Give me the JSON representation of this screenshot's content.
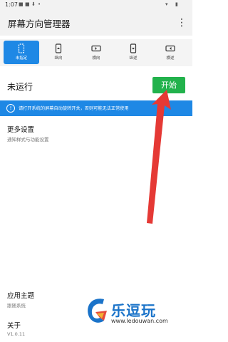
{
  "status_bar": {
    "time": "1:07",
    "icons": [
      "app-icon",
      "app-icon",
      "download-icon",
      "dot-icon",
      "wifi-icon",
      "battery-icon"
    ]
  },
  "app": {
    "title": "屏幕方向管理器",
    "menu_icon": "more-vert-icon"
  },
  "modes": [
    {
      "label": "未指定",
      "icon": "phone-outline-icon",
      "selected": true
    },
    {
      "label": "纵向",
      "icon": "portrait-icon",
      "selected": false
    },
    {
      "label": "横向",
      "icon": "landscape-icon",
      "selected": false
    },
    {
      "label": "纵逆",
      "icon": "portrait-reverse-icon",
      "selected": false
    },
    {
      "label": "横逆",
      "icon": "landscape-reverse-icon",
      "selected": false
    }
  ],
  "status": {
    "text": "未运行",
    "start_label": "开始"
  },
  "notice": {
    "text": "请打开系统的屏幕自动旋转开关，否则可能无法正常使用"
  },
  "more_settings": {
    "title": "更多设置",
    "subtitle": "通知样式与功能设置"
  },
  "theme": {
    "title": "应用主题",
    "subtitle": "跟随系统"
  },
  "about": {
    "title": "关于",
    "subtitle": "V1.0.11"
  },
  "watermark": {
    "text": "乐逗玩",
    "url": "www.ledouwan.com"
  },
  "colors": {
    "accent": "#1e88e5",
    "start": "#22b24c",
    "arrow": "#e53935"
  }
}
